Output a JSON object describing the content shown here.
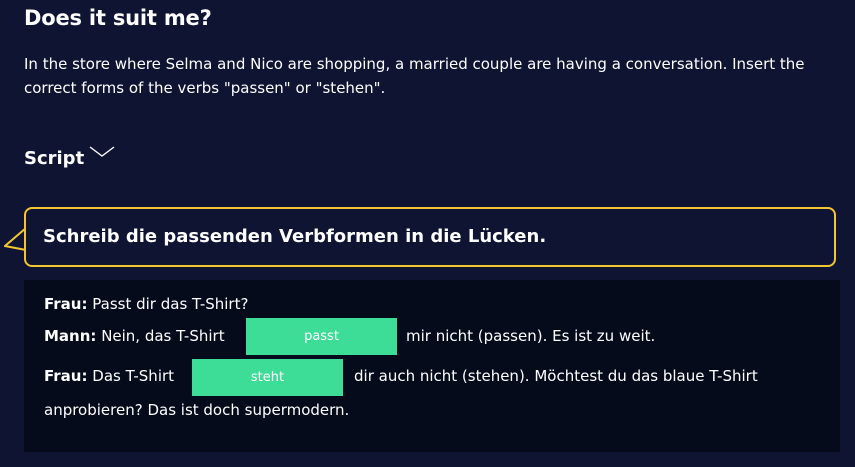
{
  "title": "Does it suit me?",
  "intro": "In the store where Selma and Nico are shopping, a married couple are having a conversation. Insert the correct forms of the verbs \"passen\" or \"stehen\".",
  "script_label": "Script",
  "instruction": "Schreib die passenden Verbformen in die Lücken.",
  "dialogue": {
    "line1": {
      "speaker": "Frau:",
      "text": "Passt dir das T-Shirt?"
    },
    "line2": {
      "speaker": "Mann:",
      "before": "Nein, das T-Shirt",
      "answer": "passt",
      "after": "mir nicht (passen). Es ist zu weit."
    },
    "line3": {
      "speaker": "Frau:",
      "before": "Das T-Shirt",
      "answer": "steht",
      "after": "dir auch nicht (stehen). Möchtest du das blaue T-Shirt"
    },
    "line4": {
      "text": "anprobieren? Das ist doch supermodern."
    }
  },
  "colors": {
    "background": "#0f1433",
    "panel": "#060b1c",
    "accent_yellow": "#f2c532",
    "answer_green": "#3ddc97"
  },
  "icons": {
    "script_toggle": "chevron-down-icon"
  }
}
